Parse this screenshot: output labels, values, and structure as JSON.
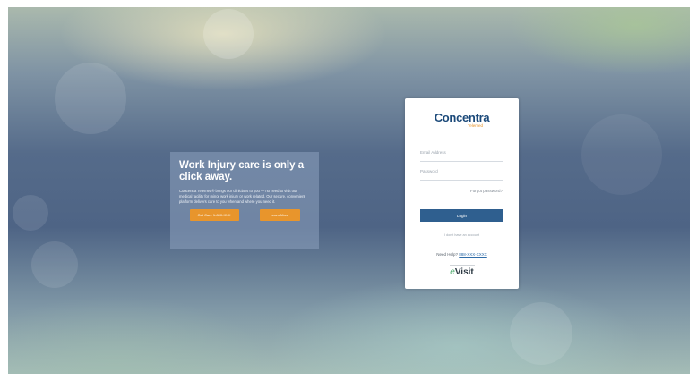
{
  "promo": {
    "title": "Work Injury care is only a click away.",
    "text": "Concentra Telemed® brings our clinicians to you — no need to visit our medical facility for minor work injury or work related. Our secure, convenient platform delivers care to you when and where you need it.",
    "buttons": [
      "Get Care 1-800-XXX",
      "Learn More"
    ]
  },
  "login": {
    "logo_main": "Concentra",
    "logo_sub": "Telemed",
    "email_placeholder": "Email Address",
    "password_placeholder": "Password",
    "forgot_label": "Forgot password?",
    "login_label": "Login",
    "no_account": "I don't have an account",
    "help_label": "Need Help?",
    "help_phone": "888-XXX-XXXX",
    "powered_brand_prefix": "e",
    "powered_brand": "Visit"
  },
  "colors": {
    "accent": "#e8952c",
    "brand": "#1c4a7a",
    "button": "#2f5f8f"
  }
}
